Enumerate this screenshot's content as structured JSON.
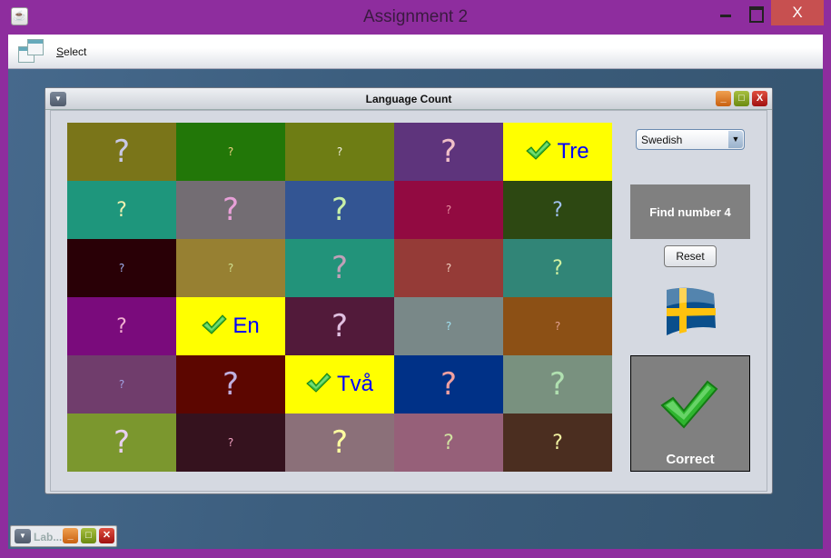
{
  "window": {
    "title": "Assignment 2",
    "icon": "java-icon",
    "close_label": "X"
  },
  "menubar": {
    "items": [
      {
        "label": "Select",
        "mnemonic": "S",
        "rest": "elect",
        "icon": "windows-icon"
      }
    ]
  },
  "internal_frame": {
    "title": "Language Count",
    "close_label": "X",
    "min_label": "_"
  },
  "minimized_frame": {
    "title": "Lab..."
  },
  "colors": {
    "answer_bg": "#ffff00",
    "answer_text": "#0000ff",
    "titlebar": "#8e2d9e",
    "panel": "#808080"
  },
  "grid": {
    "cells": [
      {
        "bg": "#7a7519",
        "q": "?",
        "qc": "#c8c8e6",
        "size": "L"
      },
      {
        "bg": "#227708",
        "q": "?",
        "qc": "#f0d080",
        "size": "S"
      },
      {
        "bg": "#6e7d14",
        "q": "?",
        "qc": "#f0f0e0",
        "size": "S"
      },
      {
        "bg": "#5e347c",
        "q": "?",
        "qc": "#f0c0c8",
        "size": "L"
      },
      {
        "bg": "#ffff00",
        "answer": "Tre"
      },
      {
        "bg": "#1e967c",
        "q": "?",
        "qc": "#f0f0b0",
        "size": "M"
      },
      {
        "bg": "#736d73",
        "q": "?",
        "qc": "#e8a0d8",
        "size": "L"
      },
      {
        "bg": "#335593",
        "q": "?",
        "qc": "#c8f0a8",
        "size": "L"
      },
      {
        "bg": "#920a41",
        "q": "?",
        "qc": "#e890a0",
        "size": "S"
      },
      {
        "bg": "#2d4812",
        "q": "?",
        "qc": "#a0c0f0",
        "size": "M"
      },
      {
        "bg": "#290006",
        "q": "?",
        "qc": "#a0b0f0",
        "size": "S"
      },
      {
        "bg": "#978032",
        "q": "?",
        "qc": "#d0e090",
        "size": "S"
      },
      {
        "bg": "#22937a",
        "q": "?",
        "qc": "#c0a0b8",
        "size": "L"
      },
      {
        "bg": "#953b37",
        "q": "?",
        "qc": "#f0d0c0",
        "size": "S"
      },
      {
        "bg": "#318577",
        "q": "?",
        "qc": "#d0f0a0",
        "size": "M"
      },
      {
        "bg": "#7a0b7c",
        "q": "?",
        "qc": "#f0b0d0",
        "size": "M"
      },
      {
        "bg": "#ffff00",
        "answer": "En"
      },
      {
        "bg": "#521a3a",
        "q": "?",
        "qc": "#e0c0e0",
        "size": "L"
      },
      {
        "bg": "#798888",
        "q": "?",
        "qc": "#a0e0f0",
        "size": "S"
      },
      {
        "bg": "#8c5015",
        "q": "?",
        "qc": "#e0a090",
        "size": "S"
      },
      {
        "bg": "#703d6c",
        "q": "?",
        "qc": "#a0a0e0",
        "size": "S"
      },
      {
        "bg": "#5c0600",
        "q": "?",
        "qc": "#c0b0e0",
        "size": "L"
      },
      {
        "bg": "#ffff00",
        "answer": "Två"
      },
      {
        "bg": "#003187",
        "q": "?",
        "qc": "#f0a0a0",
        "size": "L"
      },
      {
        "bg": "#79917f",
        "q": "?",
        "qc": "#b0e0b0",
        "size": "L"
      },
      {
        "bg": "#7b972e",
        "q": "?",
        "qc": "#e8d0f0",
        "size": "L"
      },
      {
        "bg": "#35121e",
        "q": "?",
        "qc": "#f0a0c0",
        "size": "S"
      },
      {
        "bg": "#8b7079",
        "q": "?",
        "qc": "#ffffa0",
        "size": "L"
      },
      {
        "bg": "#966079",
        "q": "?",
        "qc": "#d0e0a0",
        "size": "M"
      },
      {
        "bg": "#4b2e20",
        "q": "?",
        "qc": "#f0f0a0",
        "size": "M"
      }
    ]
  },
  "controls": {
    "language_select": {
      "value": "Swedish"
    },
    "prompt": "Find number 4",
    "reset_label": "Reset",
    "flag": "sweden-flag-icon",
    "feedback": "Correct"
  }
}
